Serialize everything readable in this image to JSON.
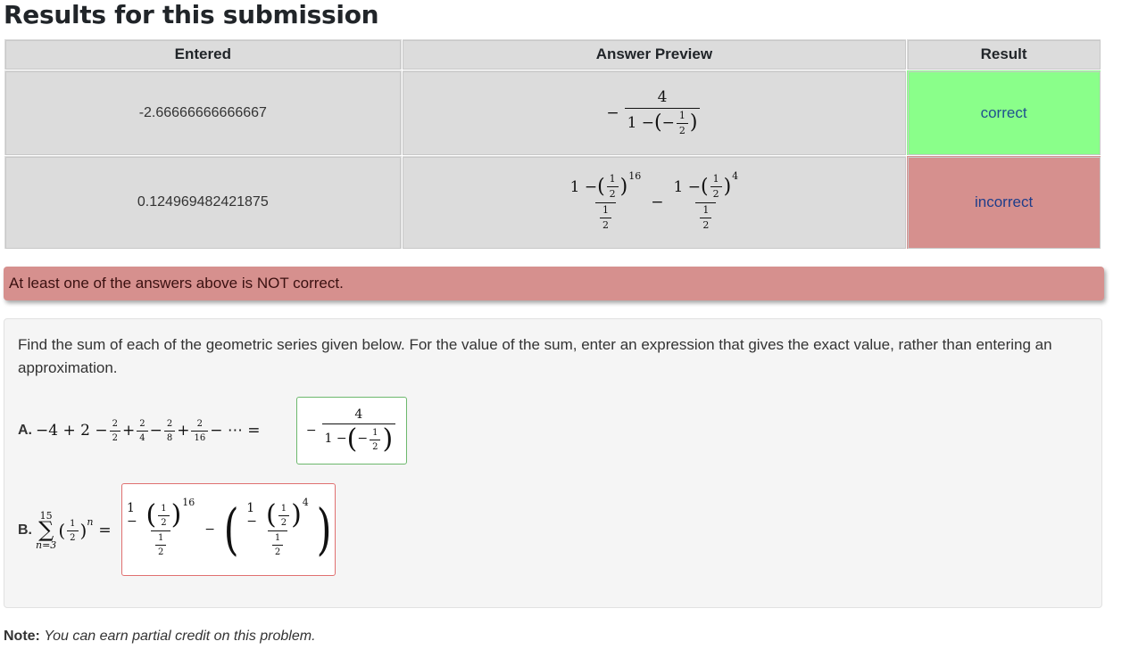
{
  "page_title": "Results for this submission",
  "table": {
    "headers": {
      "entered": "Entered",
      "preview": "Answer Preview",
      "result": "Result"
    },
    "rows": [
      {
        "entered": "-2.66666666666667",
        "result": "correct",
        "status_color": "#8aff8a"
      },
      {
        "entered": "0.124969482421875",
        "result": "incorrect",
        "status_color": "#d6908e"
      }
    ]
  },
  "alert": {
    "text": "At least one of the answers above is NOT correct.",
    "color": "#d6908e"
  },
  "problem": {
    "text": "Find the sum of each of the geometric series given below. For the value of the sum, enter an expression that gives the exact value, rather than entering an approximation.",
    "part_a_label": "A.",
    "part_b_label": "B.",
    "sum_lower": "n=3",
    "sum_upper": "15",
    "exponent_16": "16",
    "exponent_4": "4"
  },
  "note": {
    "label": "Note:",
    "text": "You can earn partial credit on this problem."
  },
  "icons": {}
}
